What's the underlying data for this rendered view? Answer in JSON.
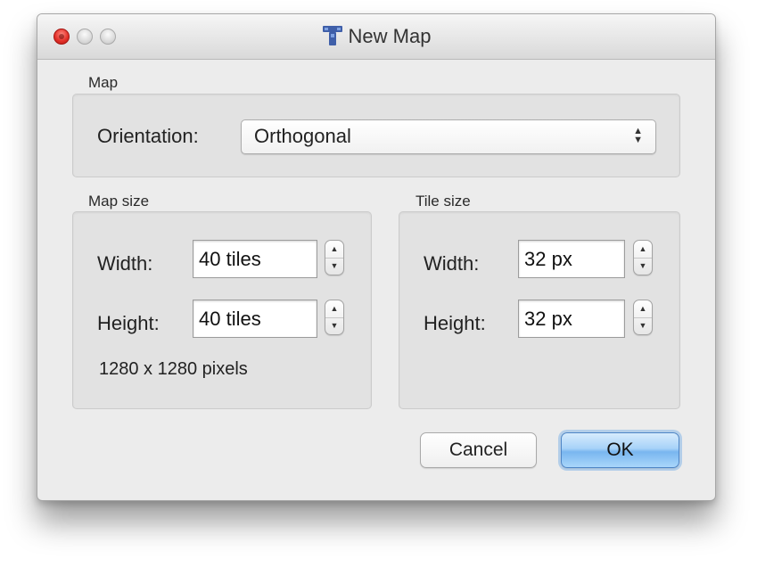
{
  "window": {
    "title": "New Map",
    "app_icon": "tiled-app-icon"
  },
  "map_section": {
    "label": "Map",
    "orientation_label": "Orientation:",
    "orientation_value": "Orthogonal"
  },
  "map_size": {
    "label": "Map size",
    "width_label": "Width:",
    "width_value": "40 tiles",
    "height_label": "Height:",
    "height_value": "40 tiles",
    "pixels_text": "1280 x 1280 pixels"
  },
  "tile_size": {
    "label": "Tile size",
    "width_label": "Width:",
    "width_value": "32 px",
    "height_label": "Height:",
    "height_value": "32 px"
  },
  "buttons": {
    "cancel": "Cancel",
    "ok": "OK"
  },
  "colors": {
    "close_button": "#e4322b",
    "default_button": "#79b6ef",
    "app_icon": "#3f5fa9"
  }
}
